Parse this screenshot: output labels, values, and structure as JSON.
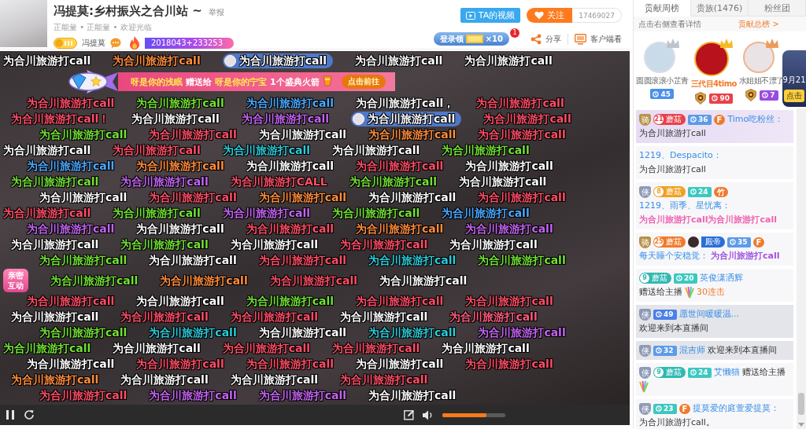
{
  "header": {
    "title": "冯提莫:乡村振兴之合川站 ~",
    "report": "举报",
    "tags": "正能量 • 正能量 • 欢迎光临",
    "host_name": "冯提莫",
    "heat": "2018043+233253",
    "video_button": "TA的视频",
    "follow_button": "关注",
    "follower_count": "17469027",
    "login_reward": {
      "label": "登录领",
      "multiplier": "×10",
      "badge": "1"
    },
    "share": "分享",
    "client": "客户端看"
  },
  "video": {
    "gift_banner": {
      "sender": "呀是你的浅眠",
      "verb": "赠送给",
      "receiver": "呀是你的宁宝",
      "gift": "1个盛典火箭",
      "action": "点击前往"
    },
    "danmaku_rows": [
      {
        "items": [
          {
            "kind": "plain",
            "text": "为合川旅游打call",
            "color": "#ffffff"
          },
          {
            "kind": "plain",
            "text": "为合川旅游打call",
            "color": "#ff8c3c"
          },
          {
            "kind": "bubble",
            "text": "为合川旅游打call"
          },
          {
            "kind": "plain",
            "text": "为合川旅游打call",
            "color": "#ffffff"
          },
          {
            "kind": "plain",
            "text": "为合川旅游打call",
            "color": "#ffffff"
          }
        ]
      },
      {
        "items": [
          {
            "kind": "plain",
            "text": "为合川旅游打call",
            "color": "#ff4d66"
          },
          {
            "kind": "plain",
            "text": "为合川旅游打call",
            "color": "#72e034"
          },
          {
            "kind": "plain",
            "text": "为合川旅游打call",
            "color": "#4aa8ff"
          },
          {
            "kind": "plain",
            "text": "为合川旅游打call，",
            "color": "#ffffff"
          },
          {
            "kind": "plain",
            "text": "为合川旅游打call",
            "color": "#ff4d66"
          }
        ]
      },
      {
        "items": [
          {
            "kind": "plain",
            "text": "为合川旅游打call！",
            "color": "#ff4d66"
          },
          {
            "kind": "plain",
            "text": "为合川旅游打call",
            "color": "#ffffff"
          },
          {
            "kind": "plain",
            "text": "为合川旅游打call",
            "color": "#c463f2"
          },
          {
            "kind": "bubble",
            "text": "为合川旅游打call"
          },
          {
            "kind": "plain",
            "text": "为合川旅游打call",
            "color": "#ff4d66"
          }
        ]
      },
      {
        "items": [
          {
            "kind": "plain",
            "text": "为合川旅游打call",
            "color": "#72e034"
          },
          {
            "kind": "plain",
            "text": "为合川旅游打call",
            "color": "#ff4d66"
          },
          {
            "kind": "plain",
            "text": "为合川旅游打call",
            "color": "#ffffff"
          },
          {
            "kind": "plain",
            "text": "为合川旅游打call",
            "color": "#ff8c3c"
          },
          {
            "kind": "plain",
            "text": "为合川旅游打call",
            "color": "#ff4d66"
          }
        ]
      },
      {
        "items": [
          {
            "kind": "plain",
            "text": "为合川旅游打call",
            "color": "#ffffff"
          },
          {
            "kind": "plain",
            "text": "为合川旅游打call",
            "color": "#ff4d66"
          },
          {
            "kind": "plain",
            "text": "为合川旅游打call",
            "color": "#2ccad8"
          },
          {
            "kind": "plain",
            "text": "为合川旅游打call",
            "color": "#ffffff"
          },
          {
            "kind": "plain",
            "text": "为合川旅游打call",
            "color": "#72e034"
          }
        ]
      },
      {
        "items": [
          {
            "kind": "plain",
            "text": "为合川旅游打call",
            "color": "#4aa8ff"
          },
          {
            "kind": "plain",
            "text": "为合川旅游打call",
            "color": "#ff8c3c"
          },
          {
            "kind": "plain",
            "text": "为合川旅游打call",
            "color": "#ffffff"
          },
          {
            "kind": "plain",
            "text": "为合川旅游打call",
            "color": "#ff4d66"
          },
          {
            "kind": "plain",
            "text": "为合川旅游打call",
            "color": "#ffffff"
          }
        ]
      },
      {
        "items": [
          {
            "kind": "plain",
            "text": "为合川旅游打call",
            "color": "#72e034"
          },
          {
            "kind": "plain",
            "text": "为合川旅游打call",
            "color": "#c463f2"
          },
          {
            "kind": "plain",
            "text": "为合川旅游打CALL",
            "color": "#ff4d66"
          },
          {
            "kind": "plain",
            "text": "为合川旅游打call",
            "color": "#72e034"
          },
          {
            "kind": "plain",
            "text": "为合川旅游打call",
            "color": "#ffffff"
          }
        ]
      },
      {
        "items": [
          {
            "kind": "plain",
            "text": "为合川旅游打call",
            "color": "#ffffff"
          },
          {
            "kind": "plain",
            "text": "为合川旅游打call",
            "color": "#ff4d66"
          },
          {
            "kind": "plain",
            "text": "为合川旅游打call",
            "color": "#ff8c3c"
          },
          {
            "kind": "plain",
            "text": "为合川旅游打call",
            "color": "#ffffff"
          },
          {
            "kind": "plain",
            "text": "为合川旅游打call",
            "color": "#ff4d66"
          }
        ]
      },
      {
        "items": [
          {
            "kind": "plain",
            "text": "为合川旅游打call",
            "color": "#ff4d66"
          },
          {
            "kind": "plain",
            "text": "为合川旅游打call",
            "color": "#72e034"
          },
          {
            "kind": "plain",
            "text": "为合川旅游打call",
            "color": "#c463f2"
          },
          {
            "kind": "plain",
            "text": "为合川旅游打call",
            "color": "#72e034"
          },
          {
            "kind": "plain",
            "text": "为合川旅游打call",
            "color": "#4aa8ff"
          }
        ]
      },
      {
        "items": [
          {
            "kind": "plain",
            "text": "为合川旅游打call",
            "color": "#c463f2"
          },
          {
            "kind": "plain",
            "text": "为合川旅游打call",
            "color": "#ffffff"
          },
          {
            "kind": "plain",
            "text": "为合川旅游打call",
            "color": "#ff4d66"
          },
          {
            "kind": "plain",
            "text": "为合川旅游打call",
            "color": "#ff8c3c"
          },
          {
            "kind": "plain",
            "text": "为合川旅游打call",
            "color": "#c463f2"
          }
        ]
      },
      {
        "items": [
          {
            "kind": "plain",
            "text": "为合川旅游打call",
            "color": "#ffffff"
          },
          {
            "kind": "plain",
            "text": "为合川旅游打call",
            "color": "#72e034"
          },
          {
            "kind": "plain",
            "text": "为合川旅游打call",
            "color": "#ffffff"
          },
          {
            "kind": "plain",
            "text": "为合川旅游打call",
            "color": "#ff4d66"
          },
          {
            "kind": "plain",
            "text": "为合川旅游打call",
            "color": "#ffffff"
          }
        ]
      },
      {
        "items": [
          {
            "kind": "plain",
            "text": "为合川旅游打call",
            "color": "#72e034"
          },
          {
            "kind": "plain",
            "text": "为合川旅游打call",
            "color": "#ffffff"
          },
          {
            "kind": "plain",
            "text": "为合川旅游打call",
            "color": "#ff4d66"
          },
          {
            "kind": "plain",
            "text": "为合川旅游打call",
            "color": "#2ccad8"
          },
          {
            "kind": "plain",
            "text": "为合川旅游打call",
            "color": "#72e034"
          }
        ]
      },
      {
        "interaction_badge": "亲密互动",
        "items": [
          {
            "kind": "plain",
            "text": "为合川旅游打call",
            "color": "#72e034"
          },
          {
            "kind": "plain",
            "text": "为合川旅游打call",
            "color": "#ff8c3c"
          },
          {
            "kind": "plain",
            "text": "为合川旅游打call",
            "color": "#ff4d66"
          },
          {
            "kind": "plain",
            "text": "为合川旅游打call",
            "color": "#ffffff"
          }
        ]
      },
      {
        "items": [
          {
            "kind": "plain",
            "text": "为合川旅游打call",
            "color": "#ff4d66"
          },
          {
            "kind": "plain",
            "text": "为合川旅游打call",
            "color": "#ffffff"
          },
          {
            "kind": "plain",
            "text": "为合川旅游打call",
            "color": "#72e034"
          },
          {
            "kind": "plain",
            "text": "为合川旅游打call",
            "color": "#ff4d66"
          },
          {
            "kind": "plain",
            "text": "为合川旅游打call",
            "color": "#ff4d66"
          }
        ]
      },
      {
        "items": [
          {
            "kind": "plain",
            "text": "为合川旅游打call",
            "color": "#ffffff"
          },
          {
            "kind": "plain",
            "text": "为合川旅游打call",
            "color": "#ff4d66"
          },
          {
            "kind": "plain",
            "text": "为合川旅游打call",
            "color": "#ff4d66"
          },
          {
            "kind": "plain",
            "text": "为合川旅游打call",
            "color": "#ffffff"
          },
          {
            "kind": "plain",
            "text": "为合川旅游打call",
            "color": "#ff5a7e"
          }
        ]
      },
      {
        "items": [
          {
            "kind": "plain",
            "text": "为合川旅游打call",
            "color": "#72e034"
          },
          {
            "kind": "plain",
            "text": "为合川旅游打call",
            "color": "#2ccad8"
          },
          {
            "kind": "plain",
            "text": "为合川旅游打call",
            "color": "#ffffff"
          },
          {
            "kind": "plain",
            "text": "为合川旅游打call",
            "color": "#2ccad8"
          },
          {
            "kind": "plain",
            "text": "为合川旅游打call",
            "color": "#c463f2"
          }
        ]
      },
      {
        "items": [
          {
            "kind": "plain",
            "text": "为合川旅游打call",
            "color": "#72e034"
          },
          {
            "kind": "plain",
            "text": "为合川旅游打call",
            "color": "#ffffff"
          },
          {
            "kind": "plain",
            "text": "为合川旅游打call",
            "color": "#ff4d66"
          },
          {
            "kind": "plain",
            "text": "为合川旅游打call",
            "color": "#ff4d66"
          },
          {
            "kind": "plain",
            "text": "为合川旅游打call",
            "color": "#ffffff"
          }
        ]
      },
      {
        "items": [
          {
            "kind": "plain",
            "text": "为合川旅游打call",
            "color": "#ffffff"
          },
          {
            "kind": "plain",
            "text": "为合川旅游打call",
            "color": "#ff4d66"
          },
          {
            "kind": "plain",
            "text": "为合川旅游打call",
            "color": "#ff4d66"
          },
          {
            "kind": "plain",
            "text": "为合川旅游打call",
            "color": "#ffffff"
          },
          {
            "kind": "plain",
            "text": "为合川旅游打call",
            "color": "#ff4d66"
          }
        ]
      },
      {
        "items": [
          {
            "kind": "plain",
            "text": "为合川旅游打call",
            "color": "#ff8c3c"
          },
          {
            "kind": "plain",
            "text": "为合川旅游打call",
            "color": "#ffffff"
          },
          {
            "kind": "plain",
            "text": "为合川旅游打call",
            "color": "#ffffff"
          },
          {
            "kind": "plain",
            "text": "为合川旅游打call",
            "color": "#ff4d66"
          }
        ]
      },
      {
        "items": [
          {
            "kind": "plain",
            "text": "为合川旅游打call",
            "color": "#ff4d66"
          },
          {
            "kind": "plain",
            "text": "为合川旅游打call",
            "color": "#c463f2"
          },
          {
            "kind": "plain",
            "text": "为合川旅游打call",
            "color": "#c463f2"
          },
          {
            "kind": "plain",
            "text": "为合川旅游打call",
            "color": "#ffffff"
          }
        ]
      }
    ]
  },
  "controls": {
    "playing": true,
    "volume": {
      "level": 0.7
    }
  },
  "side_panel": {
    "tabs": [
      {
        "label": "贡献周榜",
        "selected": true
      },
      {
        "label": "贵族(1476)",
        "selected": false
      },
      {
        "label": "粉丝团",
        "selected": false
      }
    ],
    "hint": "点击右侧查看详情",
    "rank_link": "贡献总榜 >",
    "top_fans": [
      {
        "kind": "silver",
        "name": "圆圆滚滚小芷青",
        "noble": false,
        "level": "45",
        "color": "#4a90e8"
      },
      {
        "kind": "gold",
        "name": "三代目4timo",
        "noble": true,
        "level": "90",
        "color": "#e8404a"
      },
      {
        "kind": "bronze",
        "name": "水姐姐不漂了",
        "noble": true,
        "level": "7",
        "color": "#9b4ce0"
      }
    ],
    "promo": {
      "date": "9月21",
      "action": "点击"
    },
    "messages": [
      {
        "kind": "chat",
        "highlighted": true,
        "badges": [
          {
            "kind": "rank",
            "text": "骑",
            "color": "#b8924a"
          },
          {
            "kind": "fan",
            "level": "21",
            "text": "蘑菇",
            "color": "#e8404a"
          },
          {
            "kind": "level",
            "text": "36",
            "color": "#5b9be8"
          },
          {
            "kind": "tag",
            "text": "F",
            "color": "#f07a2a"
          }
        ],
        "user": "Timo吃粉丝：",
        "text": "为合川旅游打call"
      },
      {
        "kind": "chat",
        "highlighted": false,
        "user": "1219、Despacito：",
        "text": "为合川旅游打call"
      },
      {
        "kind": "chat",
        "highlighted": false,
        "badges": [
          {
            "kind": "rank",
            "text": "侠",
            "color": "#8e9bb5"
          },
          {
            "kind": "fan",
            "level": "8",
            "text": "蘑菇",
            "color": "#f0a020"
          },
          {
            "kind": "level",
            "text": "24",
            "color": "#3cc8c0"
          },
          {
            "kind": "tag",
            "text": "竹",
            "color": "#f07a2a"
          }
        ],
        "user": "1219、雨季、星忧离：",
        "text": "为合川旅游打call为合川旅游打call",
        "color": "#f060b0"
      },
      {
        "kind": "chat",
        "highlighted": false,
        "badges": [
          {
            "kind": "rank",
            "text": "骑",
            "color": "#b8924a"
          },
          {
            "kind": "fan",
            "level": "25",
            "text": "蘑菇",
            "color": "#f07a2a"
          },
          {
            "kind": "noble",
            "text": "殿帝",
            "color": "#2a6fd8"
          },
          {
            "kind": "level",
            "text": "35",
            "color": "#5b9be8"
          },
          {
            "kind": "tag",
            "text": "F",
            "color": "#f07a2a"
          }
        ],
        "user": "每天睡个安稳觉：",
        "text": "为合川旅游打call",
        "color": "#a050e0"
      },
      {
        "kind": "gift",
        "highlighted": false,
        "badges": [
          {
            "kind": "fan",
            "level": "9",
            "text": "蘑菇",
            "color": "#2fb8b0"
          },
          {
            "kind": "level",
            "text": "20",
            "color": "#3cc8c0"
          }
        ],
        "user": "英俊潇洒辉",
        "text": "赠送给主播",
        "combo": "30连击"
      },
      {
        "kind": "welcome",
        "highlighted": false,
        "badges": [
          {
            "kind": "rank",
            "text": "侠",
            "color": "#8e9bb5"
          },
          {
            "kind": "level",
            "text": "49",
            "color": "#4a80e8"
          }
        ],
        "user": "愿世间暖暖温...",
        "text": "欢迎来到本直播间"
      },
      {
        "kind": "welcome",
        "highlighted": false,
        "badges": [
          {
            "kind": "rank",
            "text": "侠",
            "color": "#8e9bb5"
          },
          {
            "kind": "level",
            "text": "32",
            "color": "#5b9be8"
          }
        ],
        "user": "混吉师",
        "text": "欢迎来到本直播间"
      },
      {
        "kind": "gift",
        "highlighted": false,
        "badges": [
          {
            "kind": "rank",
            "text": "侠",
            "color": "#8e9bb5"
          },
          {
            "kind": "fan",
            "level": "9",
            "text": "蘑菇",
            "color": "#2fb8b0"
          },
          {
            "kind": "level",
            "text": "24",
            "color": "#3cc8c0"
          }
        ],
        "user": "艾懒猫",
        "text": "赠送给主播"
      },
      {
        "kind": "chat",
        "highlighted": false,
        "badges": [
          {
            "kind": "rank",
            "text": "侠",
            "color": "#8e9bb5"
          },
          {
            "kind": "level",
            "text": "23",
            "color": "#3cc8c0"
          },
          {
            "kind": "tag",
            "text": "F",
            "color": "#f07a2a"
          }
        ],
        "user": "提莫爱的庭萱爱提莫：",
        "text": "为合川旅游打call。"
      }
    ]
  }
}
